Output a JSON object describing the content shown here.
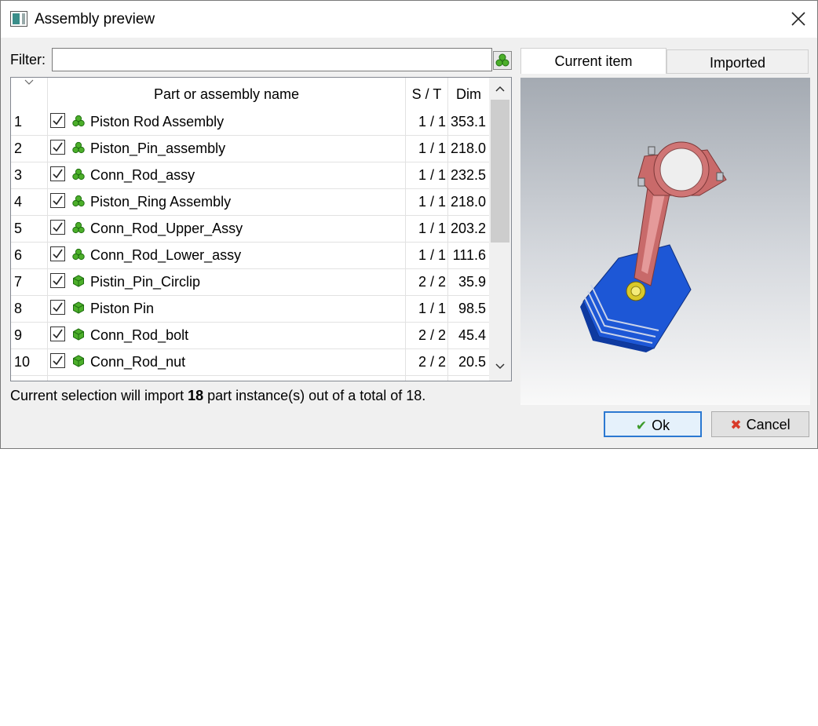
{
  "window": {
    "title": "Assembly preview"
  },
  "filter": {
    "label": "Filter:",
    "value": "",
    "placeholder": ""
  },
  "table": {
    "columns": [
      "Part or assembly name",
      "S / T",
      "Dim"
    ],
    "rows": [
      {
        "num": "1",
        "name": "Piston Rod Assembly",
        "st": "1 / 1",
        "dim": "353.1",
        "kind": "assembly",
        "checked": true
      },
      {
        "num": "2",
        "name": "Piston_Pin_assembly",
        "st": "1 / 1",
        "dim": "218.0",
        "kind": "assembly",
        "checked": true
      },
      {
        "num": "3",
        "name": "Conn_Rod_assy",
        "st": "1 / 1",
        "dim": "232.5",
        "kind": "assembly",
        "checked": true
      },
      {
        "num": "4",
        "name": "Piston_Ring Assembly",
        "st": "1 / 1",
        "dim": "218.0",
        "kind": "assembly",
        "checked": true
      },
      {
        "num": "5",
        "name": "Conn_Rod_Upper_Assy",
        "st": "1 / 1",
        "dim": "203.2",
        "kind": "assembly",
        "checked": true
      },
      {
        "num": "6",
        "name": "Conn_Rod_Lower_assy",
        "st": "1 / 1",
        "dim": "111.6",
        "kind": "assembly",
        "checked": true
      },
      {
        "num": "7",
        "name": "Pistin_Pin_Circlip",
        "st": "2 / 2",
        "dim": "35.9",
        "kind": "part",
        "checked": true
      },
      {
        "num": "8",
        "name": "Piston Pin",
        "st": "1 / 1",
        "dim": "98.5",
        "kind": "part",
        "checked": true
      },
      {
        "num": "9",
        "name": "Conn_Rod_bolt",
        "st": "2 / 2",
        "dim": "45.4",
        "kind": "part",
        "checked": true
      },
      {
        "num": "10",
        "name": "Conn_Rod_nut",
        "st": "2 / 2",
        "dim": "20.5",
        "kind": "part",
        "checked": true
      }
    ]
  },
  "status": {
    "prefix": "Current selection will import ",
    "count": "18",
    "suffix": " part instance(s) out of a total of 18."
  },
  "tabs": {
    "current": "Current item",
    "imported": "Imported"
  },
  "buttons": {
    "ok": "Ok",
    "cancel": "Cancel"
  },
  "icons": {
    "app": "window-app-icon",
    "close": "close-icon",
    "filter": "assembly-filter-icon",
    "assembly": "assembly-icon",
    "part": "part-icon",
    "ok": "checkmark-icon",
    "cancel": "cross-icon"
  },
  "colors": {
    "assembly_icon": "#4caf2a",
    "part_icon": "#4caf2a",
    "ok_border": "#2b78d1",
    "cancel_icon": "#d83b2a",
    "ok_icon": "#3c9a2a"
  }
}
